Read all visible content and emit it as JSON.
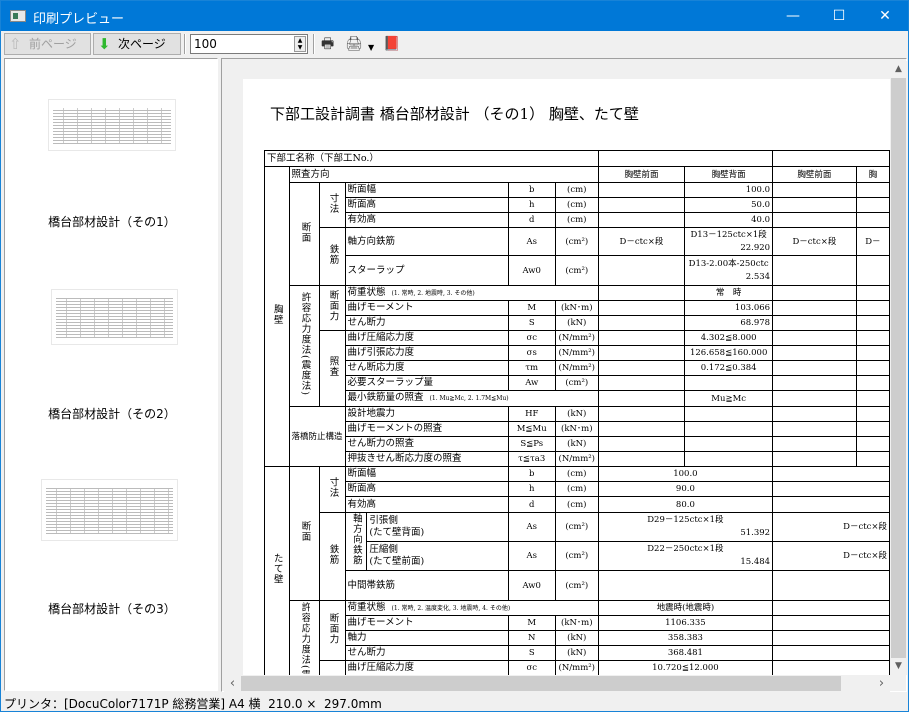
{
  "window": {
    "title": "印刷プレビュー"
  },
  "toolbar": {
    "prev_label": "前ページ",
    "next_label": "次ページ",
    "zoom_value": "100"
  },
  "thumbnails": [
    "橋台部材設計（その1）",
    "橋台部材設計（その2）",
    "橋台部材設計（その3）"
  ],
  "status": "プリンタ：[DocuColor7171P 総務営業] A4 横  210.0 ×  297.0mm",
  "page": {
    "title": "下部工設計調書  橋台部材設計 （その1）   胸壁、たて壁",
    "table": {
      "name": "下部工名称（下部工No.）",
      "direction": "照査方向",
      "dir_cols": [
        "胸壁前面",
        "胸壁背面",
        "胸壁前面",
        "胸"
      ],
      "kyoheki": {
        "label": "胸壁",
        "danmen": "断面",
        "sunpo": "寸法",
        "tekkin": "鉄筋",
        "allow": "許容応力度法(震度法)",
        "danmenryoku": "断面力",
        "shosa": "照査",
        "rakkyo": "落橋防止構造",
        "rows": [
          {
            "label": "断面幅",
            "sym": "b",
            "unit": "(cm)",
            "values": [
              "",
              "100.0",
              "",
              ""
            ]
          },
          {
            "label": "断面高",
            "sym": "h",
            "unit": "(cm)",
            "values": [
              "",
              "50.0",
              "",
              ""
            ]
          },
          {
            "label": "有効高",
            "sym": "d",
            "unit": "(cm)",
            "values": [
              "",
              "40.0",
              "",
              ""
            ]
          },
          {
            "label": "軸方向鉄筋",
            "sym": "As",
            "unit": "(cm²)",
            "values": [
              "D－ctc×段",
              [
                "D13－125ctc×1段",
                "22.920"
              ],
              "D－ctc×段",
              "D－"
            ]
          },
          {
            "label": "スターラップ",
            "sym": "Aw0",
            "unit": "(cm²)",
            "values": [
              "",
              [
                "D13-2.00本-250ctc",
                "2.534"
              ],
              "",
              ""
            ]
          },
          {
            "label": "荷重状態",
            "note": "(1. 常時, 2. 地震時, 3. その他)",
            "values": [
              "",
              "常　時",
              "",
              ""
            ]
          },
          {
            "label": "曲げモーメント",
            "sym": "M",
            "unit": "(kN･m)",
            "values": [
              "",
              "103.066",
              "",
              ""
            ]
          },
          {
            "label": "せん断力",
            "sym": "S",
            "unit": "(kN)",
            "values": [
              "",
              "68.978",
              "",
              ""
            ]
          },
          {
            "label": "曲げ圧縮応力度",
            "sym": "σc",
            "unit": "(N/mm²)",
            "values": [
              "",
              "4.302≦8.000",
              "",
              ""
            ]
          },
          {
            "label": "曲げ引張応力度",
            "sym": "σs",
            "unit": "(N/mm²)",
            "values": [
              "",
              "126.658≦160.000",
              "",
              ""
            ]
          },
          {
            "label": "せん断応力度",
            "sym": "τm",
            "unit": "(N/mm²)",
            "values": [
              "",
              "0.172≦0.384",
              "",
              ""
            ]
          },
          {
            "label": "必要スターラップ量",
            "sym": "Aw",
            "unit": "(cm²)",
            "values": [
              "",
              "",
              "",
              ""
            ]
          },
          {
            "label": "最小鉄筋量の照査",
            "note": "(1. Mu≧Mc, 2. 1.7M≦Mu)",
            "values": [
              "",
              "Mu≧Mc",
              "",
              ""
            ]
          },
          {
            "label": "設計地震力",
            "sym": "HF",
            "unit": "(kN)",
            "values": [
              "",
              "",
              "",
              ""
            ]
          },
          {
            "label": "曲げモーメントの照査",
            "sym": "M≦Mu",
            "unit": "(kN･m)",
            "values": [
              "",
              "",
              "",
              ""
            ]
          },
          {
            "label": "せん断力の照査",
            "sym": "S≦Ps",
            "unit": "(kN)",
            "values": [
              "",
              "",
              "",
              ""
            ]
          },
          {
            "label": "押抜きせん断応力度の照査",
            "sym": "τ≦τa3",
            "unit": "(N/mm²)",
            "values": [
              "",
              "",
              "",
              ""
            ]
          }
        ]
      },
      "tatekabe": {
        "label": "たて壁",
        "danmen": "断面",
        "sunpo": "寸法",
        "tekkin": "鉄筋",
        "axial": "軸方向鉄筋",
        "allow": "許容応力度法(震度法)",
        "danmenryoku": "断面力",
        "rows": [
          {
            "label": "断面幅",
            "sym": "b",
            "unit": "(cm)",
            "values": [
              "100.0",
              ""
            ]
          },
          {
            "label": "断面高",
            "sym": "h",
            "unit": "(cm)",
            "values": [
              "90.0",
              ""
            ]
          },
          {
            "label": "有効高",
            "sym": "d",
            "unit": "(cm)",
            "values": [
              "80.0",
              ""
            ]
          },
          {
            "label": "引張側",
            "sub": "(たて壁背面)",
            "sym": "As",
            "unit": "(cm²)",
            "values": [
              [
                "D29－125ctc×1段",
                "51.392"
              ],
              "D－ctc×段"
            ]
          },
          {
            "label": "圧縮側",
            "sub": "(たて壁前面)",
            "sym": "As",
            "unit": "(cm²)",
            "values": [
              [
                "D22－250ctc×1段",
                "15.484"
              ],
              "D－ctc×段"
            ]
          },
          {
            "label": "中間帯鉄筋",
            "sym": "Aw0",
            "unit": "(cm²)",
            "values": [
              "",
              ""
            ]
          },
          {
            "label": "荷重状態",
            "note": "(1. 常時, 2. 温度変化, 3. 地震時, 4. その他)",
            "values": [
              "地震時(地震時)",
              ""
            ]
          },
          {
            "label": "曲げモーメント",
            "sym": "M",
            "unit": "(kN･m)",
            "values": [
              "1106.335",
              ""
            ]
          },
          {
            "label": "軸力",
            "sym": "N",
            "unit": "(kN)",
            "values": [
              "358.383",
              ""
            ]
          },
          {
            "label": "せん断力",
            "sym": "S",
            "unit": "(kN)",
            "values": [
              "368.481",
              ""
            ]
          },
          {
            "label": "曲げ圧縮応力度",
            "sym": "σc",
            "unit": "(N/mm²)",
            "values": [
              "10.720≦12.000",
              ""
            ]
          }
        ]
      }
    }
  }
}
